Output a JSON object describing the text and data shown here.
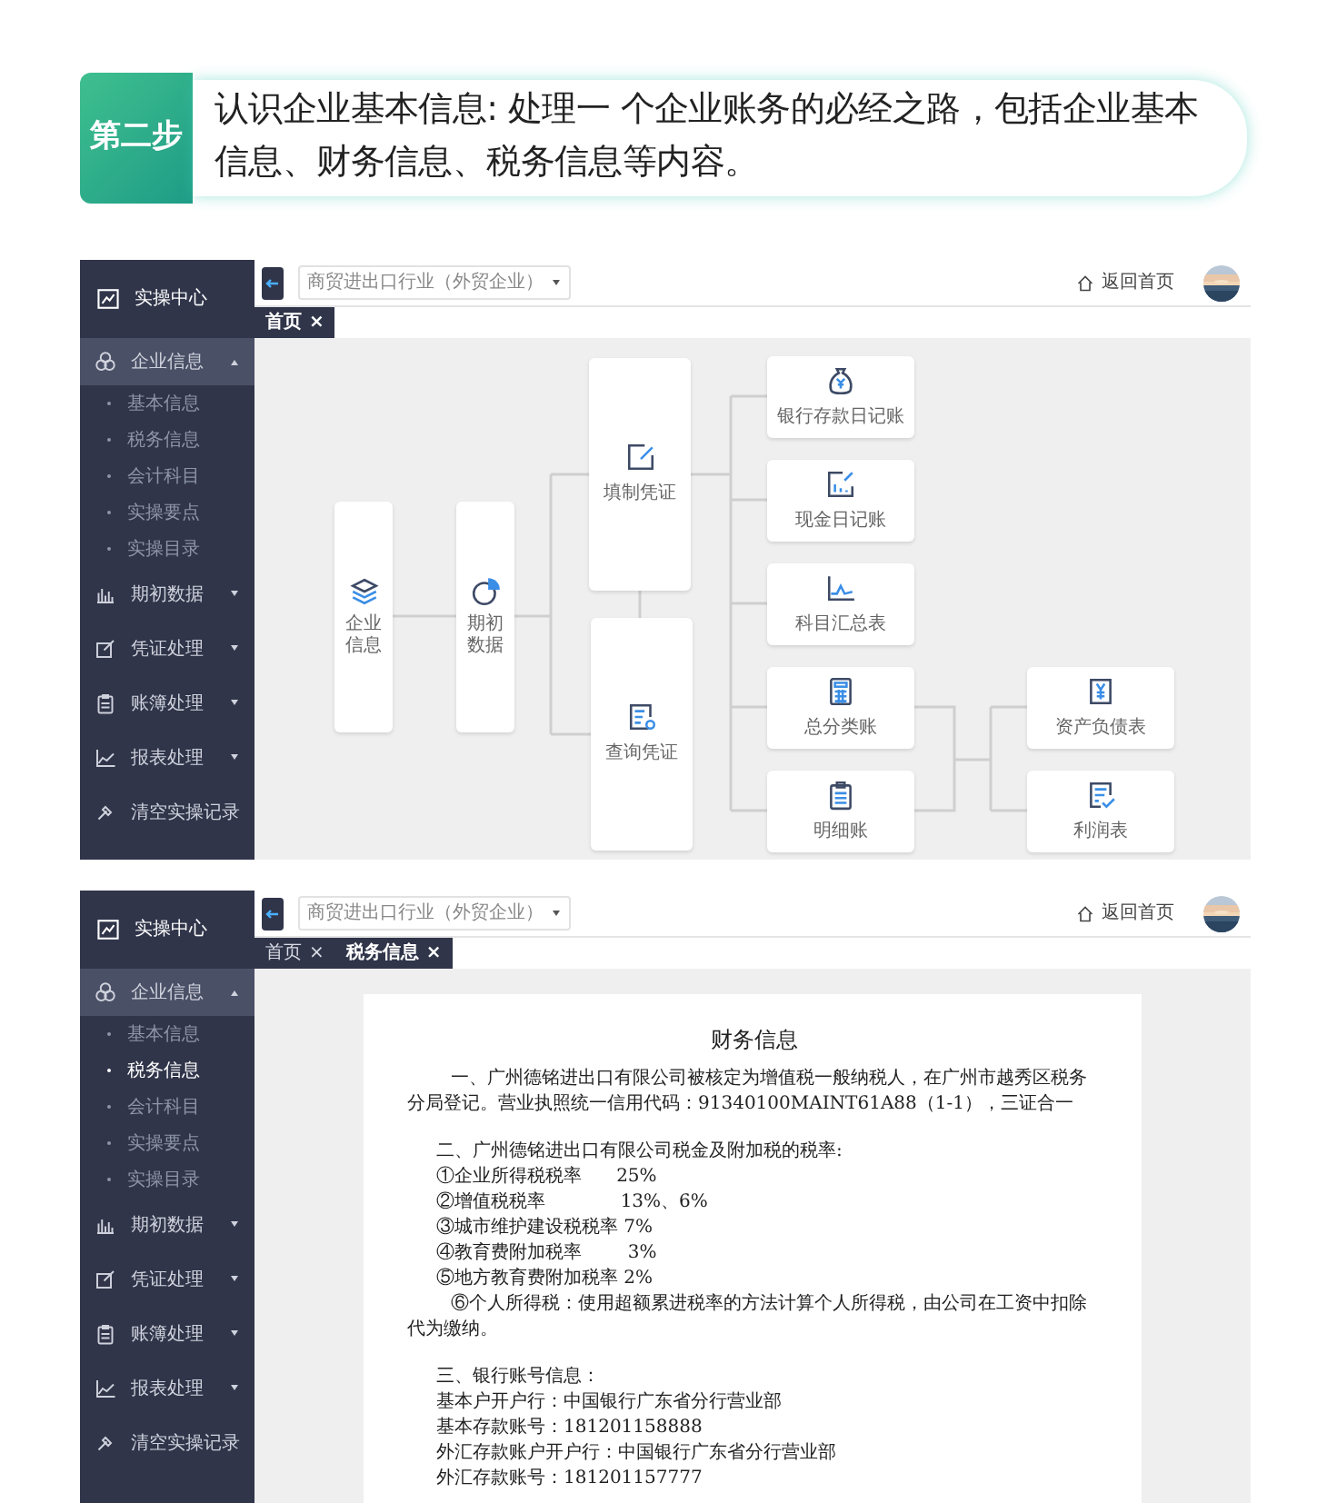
{
  "header": {
    "step": "第二步",
    "text": "认识企业基本信息: 处理一 个企业账务的必经之路，包括企业基本信息、财务信息、税务信息等内容。"
  },
  "screens": [
    {
      "sidebar": {
        "title": "实操中心",
        "items": [
          {
            "label": "企业信息",
            "selected": true,
            "expanded": true,
            "children": [
              {
                "label": "基本信息",
                "selected": false
              },
              {
                "label": "税务信息",
                "selected": false
              },
              {
                "label": "会计科目",
                "selected": false
              },
              {
                "label": "实操要点",
                "selected": false
              },
              {
                "label": "实操目录",
                "selected": false
              }
            ]
          },
          {
            "label": "期初数据",
            "selected": false,
            "expanded": false
          },
          {
            "label": "凭证处理",
            "selected": false,
            "expanded": false
          },
          {
            "label": "账簿处理",
            "selected": false,
            "expanded": false
          },
          {
            "label": "报表处理",
            "selected": false,
            "expanded": false
          }
        ],
        "footer_action": "清空实操记录"
      },
      "company_select": {
        "value": "商贸进出口行业（外贸企业）"
      },
      "home_link": "返回首页",
      "tabs": [
        {
          "label": "首页",
          "close": "×",
          "selected": true
        }
      ],
      "flowchart": {
        "nodes": [
          {
            "label": "企业信息"
          },
          {
            "label": "期初数据"
          },
          {
            "label": "填制凭证"
          },
          {
            "label": "查询凭证"
          },
          {
            "label": "银行存款日记账"
          },
          {
            "label": "现金日记账"
          },
          {
            "label": "科目汇总表"
          },
          {
            "label": "总分类账"
          },
          {
            "label": "明细账"
          },
          {
            "label": "资产负债表"
          },
          {
            "label": "利润表"
          }
        ]
      }
    },
    {
      "sidebar": {
        "title": "实操中心",
        "items": [
          {
            "label": "企业信息",
            "selected": true,
            "expanded": true,
            "children": [
              {
                "label": "基本信息",
                "selected": false
              },
              {
                "label": "税务信息",
                "selected": true
              },
              {
                "label": "会计科目",
                "selected": false
              },
              {
                "label": "实操要点",
                "selected": false
              },
              {
                "label": "实操目录",
                "selected": false
              }
            ]
          },
          {
            "label": "期初数据",
            "selected": false,
            "expanded": false
          },
          {
            "label": "凭证处理",
            "selected": false,
            "expanded": false
          },
          {
            "label": "账簿处理",
            "selected": false,
            "expanded": false
          },
          {
            "label": "报表处理",
            "selected": false,
            "expanded": false
          }
        ],
        "footer_action": "清空实操记录"
      },
      "company_select": {
        "value": "商贸进出口行业（外贸企业）"
      },
      "home_link": "返回首页",
      "tabs": [
        {
          "label": "首页",
          "close": "×",
          "selected": false
        },
        {
          "label": "税务信息",
          "close": "×",
          "selected": true
        }
      ],
      "document": {
        "title": "财务信息",
        "sections": [
          {
            "lines": [
              {
                "kind": "para",
                "text": "一、广州德铭进出口有限公司被核定为增值税一般纳税人，在广州市越秀区税务分局登记。营业执照统一信用代码：91340100MAINT61A88（1-1），三证合一"
              }
            ]
          },
          {
            "lines": [
              {
                "kind": "line",
                "text": "二、广州德铭进出口有限公司税金及附加税的税率:"
              },
              {
                "kind": "line",
                "text": "①企业所得税税率      25%"
              },
              {
                "kind": "line",
                "text": "②增值税税率             13%、6%"
              },
              {
                "kind": "line",
                "text": "③城市维护建设税税率 7%"
              },
              {
                "kind": "line",
                "text": "④教育费附加税率        3%"
              },
              {
                "kind": "line",
                "text": "⑤地方教育费附加税率 2%"
              },
              {
                "kind": "para",
                "text": "⑥个人所得税：使用超额累进税率的方法计算个人所得税，由公司在工资中扣除代为缴纳。"
              }
            ]
          },
          {
            "lines": [
              {
                "kind": "line",
                "text": "三、银行账号信息："
              },
              {
                "kind": "line",
                "text": "基本户开户行：中国银行广东省分行营业部"
              },
              {
                "kind": "line",
                "text": "基本存款账号：181201158888"
              },
              {
                "kind": "line",
                "text": "外汇存款账户开户行：中国银行广东省分行营业部"
              },
              {
                "kind": "line",
                "text": "外汇存款账号：181201157777"
              }
            ]
          }
        ]
      }
    }
  ]
}
